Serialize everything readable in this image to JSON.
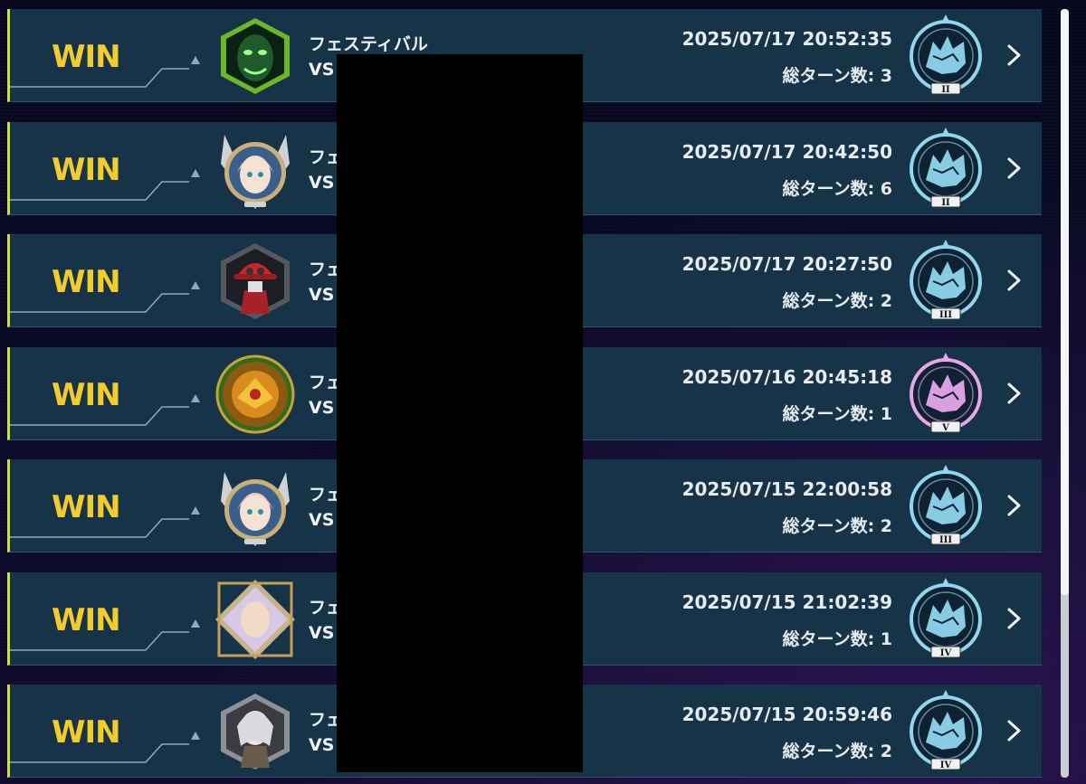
{
  "matches": [
    {
      "result": "WIN",
      "opponent": "フェスティバル",
      "vs": "VS",
      "datetime": "2025/07/17 20:52:35",
      "turns_label": "総ターン数: 3",
      "rank": "II",
      "emblem_color": "#8fd6ee",
      "avatar": "green-masked-villain"
    },
    {
      "result": "WIN",
      "opponent": "フェ",
      "vs": "VS",
      "datetime": "2025/07/17 20:42:50",
      "turns_label": "総ターン数: 6",
      "rank": "II",
      "emblem_color": "#8fd6ee",
      "avatar": "blonde-girl-frame"
    },
    {
      "result": "WIN",
      "opponent": "フェ",
      "vs": "VS",
      "datetime": "2025/07/17 20:27:50",
      "turns_label": "総ターン数: 2",
      "rank": "III",
      "emblem_color": "#8fd6ee",
      "avatar": "red-cap-figure"
    },
    {
      "result": "WIN",
      "opponent": "フェ",
      "vs": "VS",
      "datetime": "2025/07/16 20:45:18",
      "turns_label": "総ターン数: 1",
      "rank": "V",
      "emblem_color": "#e6a6e8",
      "avatar": "golden-dragon-emblem"
    },
    {
      "result": "WIN",
      "opponent": "フェ",
      "vs": "VS",
      "datetime": "2025/07/15 22:00:58",
      "turns_label": "総ターン数: 2",
      "rank": "III",
      "emblem_color": "#8fd6ee",
      "avatar": "pink-hair-girl-frame"
    },
    {
      "result": "WIN",
      "opponent": "フェ",
      "vs": "VS",
      "datetime": "2025/07/15 21:02:39",
      "turns_label": "総ターン数: 1",
      "rank": "IV",
      "emblem_color": "#8fd6ee",
      "avatar": "diamond-frame-girl"
    },
    {
      "result": "WIN",
      "opponent": "フェ",
      "vs": "VS",
      "datetime": "2025/07/15 20:59:46",
      "turns_label": "総ターン数: 2",
      "rank": "IV",
      "emblem_color": "#8fd6ee",
      "avatar": "silver-hair-character"
    }
  ],
  "colors": {
    "win": "#f2cc2e",
    "accent": "#c9e33a",
    "row_bg": "#173348"
  },
  "icons": {
    "detail": "chevron-right-icon",
    "rank": "wolf-rank-emblem-icon"
  }
}
